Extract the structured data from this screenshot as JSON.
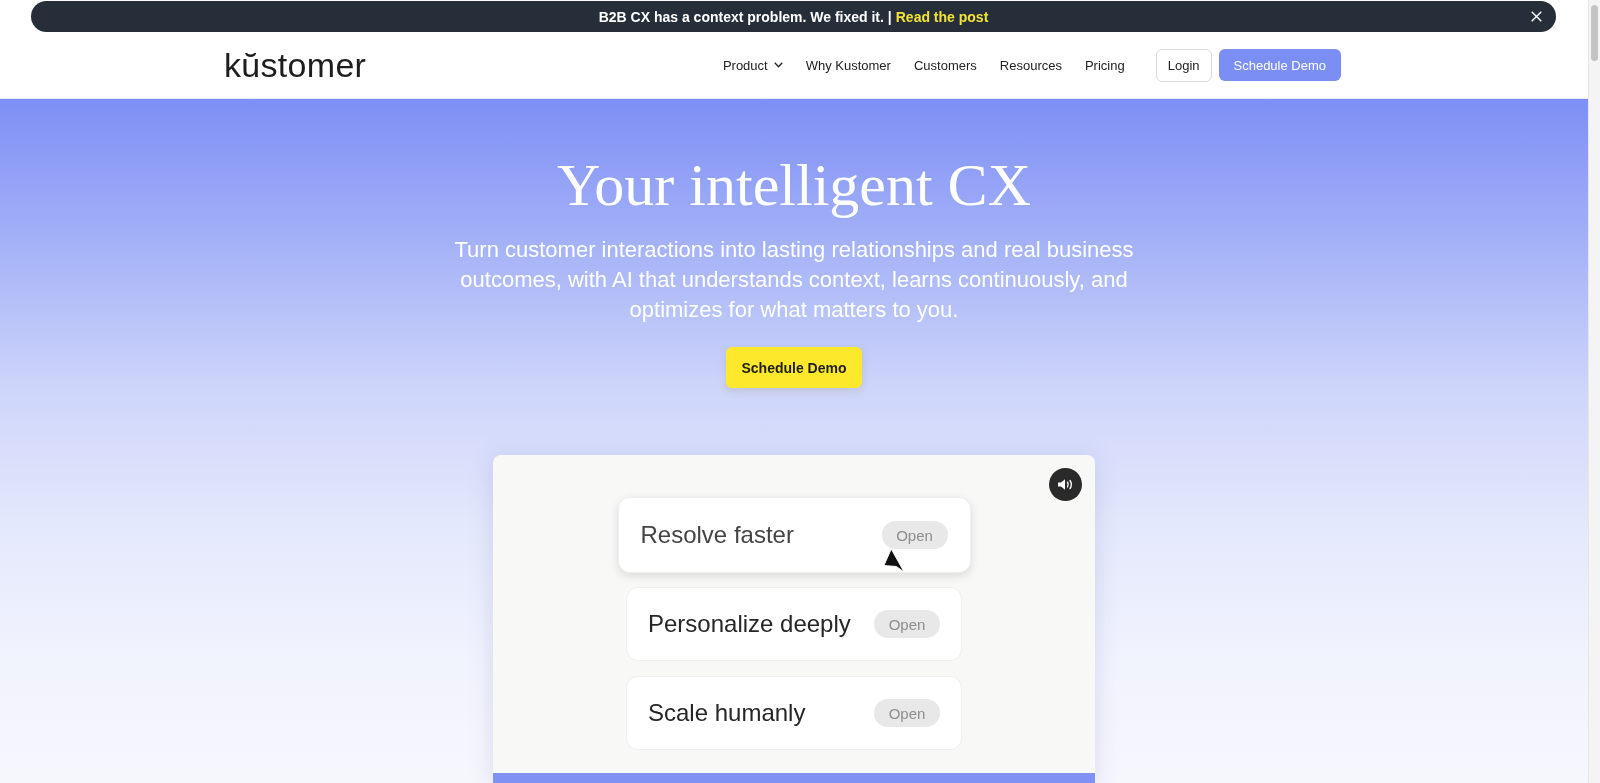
{
  "announcement": {
    "text": "B2B CX has a context problem. We fixed it. |",
    "link": "Read the post"
  },
  "nav": {
    "logo": "kŭstomer",
    "items": [
      {
        "label": "Product",
        "kind": "dropdown"
      },
      {
        "label": "Why Kustomer",
        "kind": "link"
      },
      {
        "label": "Customers",
        "kind": "link"
      },
      {
        "label": "Resources",
        "kind": "link"
      },
      {
        "label": "Pricing",
        "kind": "link"
      }
    ],
    "login": "Login",
    "cta": "Schedule Demo"
  },
  "hero": {
    "title": "Your intelligent CX",
    "subtitle": "Turn customer interactions into lasting relationships and real business outcomes, with AI that understands context, learns continuously, and optimizes for what matters to you.",
    "cta": "Schedule Demo"
  },
  "video": {
    "cards": [
      {
        "title": "Resolve faster",
        "action": "Open",
        "hovered": true
      },
      {
        "title": "Personalize deeply",
        "action": "Open",
        "hovered": false
      },
      {
        "title": "Scale humanly",
        "action": "Open",
        "hovered": false
      }
    ]
  }
}
